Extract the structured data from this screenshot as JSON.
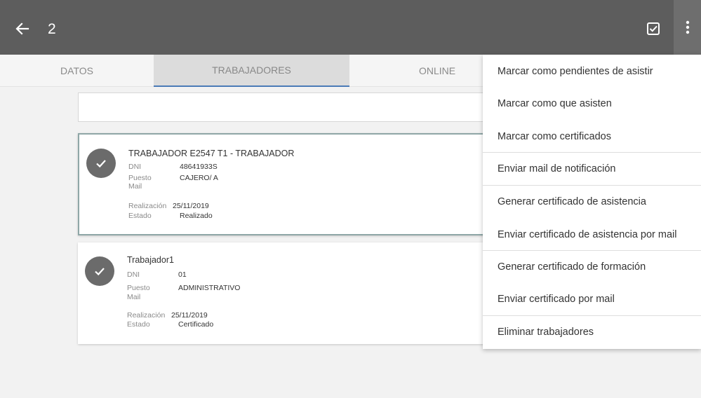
{
  "appbar": {
    "title": "2",
    "back_icon": "arrow-left-icon",
    "action_icon": "checkbox-checked-icon",
    "more_icon": "more-vertical-icon",
    "bar_color": "#5d5d5d"
  },
  "tabs": [
    {
      "label": "DATOS"
    },
    {
      "label": "TRABAJADORES"
    },
    {
      "label": "ONLINE"
    }
  ],
  "workers": [
    {
      "name": "TRABAJADOR E2547 T1 - TRABAJADOR",
      "dni_label": "DNI",
      "dni": "48641933S",
      "puesto_label": "Puesto",
      "puesto": "CAJERO/ A",
      "mail_label": "Mail",
      "mail": "",
      "realizacion_label": "Realización",
      "realizacion": "25/11/2019",
      "estado_label": "Estado",
      "estado": "Realizado"
    },
    {
      "name": "Trabajador1",
      "dni_label": "DNI",
      "dni": "01",
      "puesto_label": "Puesto",
      "puesto": "ADMINISTRATIVO",
      "mail_label": "Mail",
      "mail": "",
      "realizacion_label": "Realización",
      "realizacion": "25/11/2019",
      "estado_label": "Estado",
      "estado": "Certificado"
    }
  ],
  "menu": [
    {
      "label": "Marcar como pendientes de asistir"
    },
    {
      "label": "Marcar como que asisten"
    },
    {
      "label": "Marcar como certificados"
    },
    {
      "label": "Enviar mail de notificación"
    },
    {
      "label": "Generar certificado de asistencia"
    },
    {
      "label": "Enviar certificado de asistencia por mail"
    },
    {
      "label": "Generar certificado de formación"
    },
    {
      "label": "Enviar certificado por mail"
    },
    {
      "label": "Eliminar trabajadores"
    }
  ]
}
